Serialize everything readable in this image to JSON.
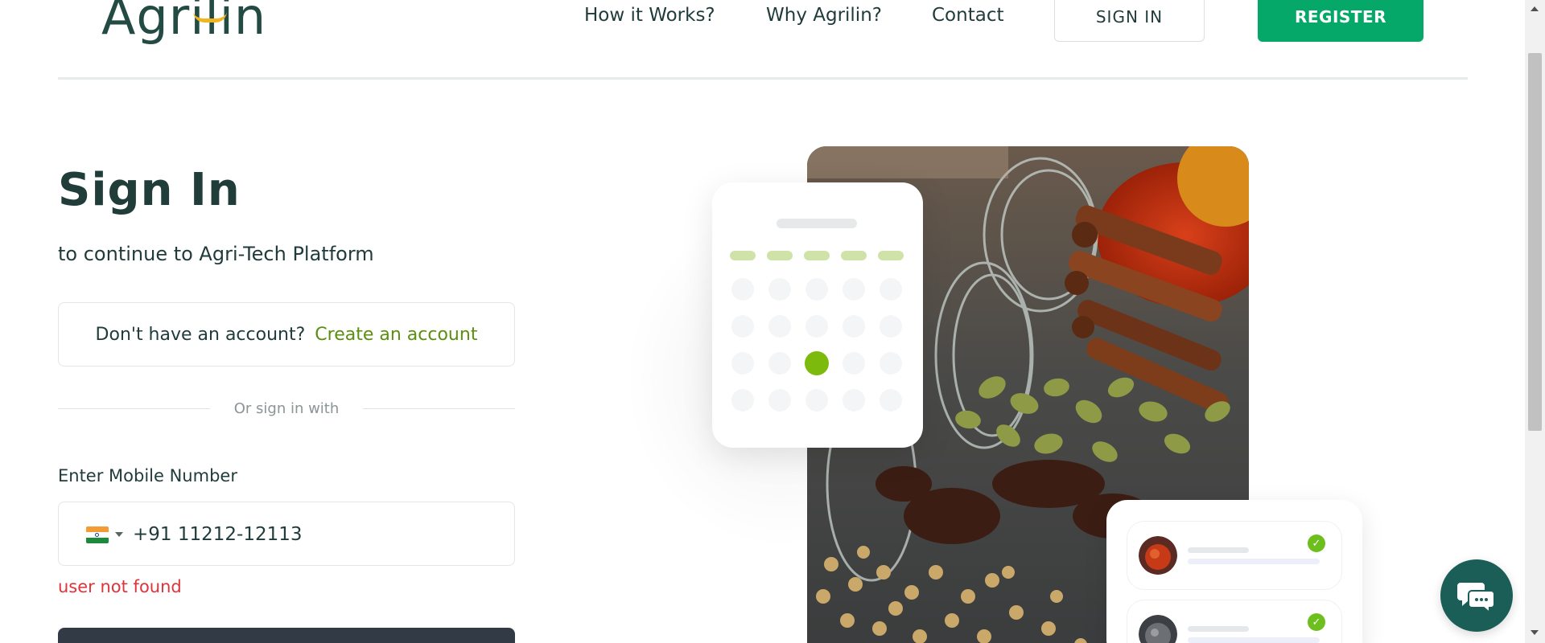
{
  "header": {
    "logo_text": "Agrilin",
    "nav": [
      "How it Works?",
      "Why Agrilin?",
      "Contact"
    ],
    "signin_label": "SIGN IN",
    "register_label": "REGISTER"
  },
  "form": {
    "title": "Sign In",
    "subtitle": "to continue to Agri-Tech Platform",
    "no_account_text": "Don't have an account?",
    "create_account_link": "Create an account",
    "divider_text": "Or sign in with",
    "mobile_label": "Enter Mobile Number",
    "mobile_value": "+91 11212-12113",
    "country": "India",
    "error_text": "user not found"
  },
  "icons": {
    "chat": "chat-bubbles-icon",
    "check": "check-icon",
    "country_caret": "caret-down-icon"
  },
  "colors": {
    "brand_green": "#06a869",
    "link_green": "#5a8f10",
    "text_dark": "#1f3b3a",
    "error_red": "#e0333a",
    "chat_teal": "#1b5e57",
    "button_dark": "#323b45"
  }
}
